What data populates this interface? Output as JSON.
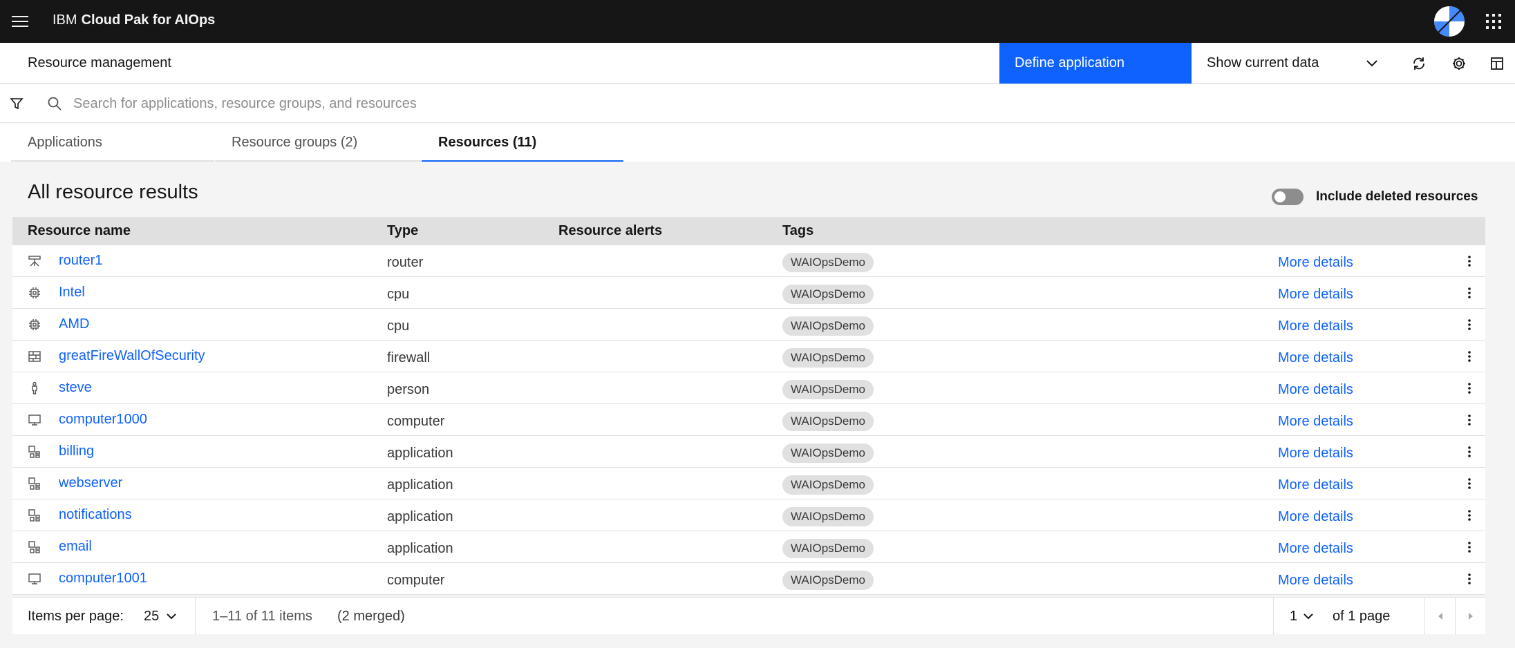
{
  "shell": {
    "brand_prefix": "IBM",
    "brand_product": "Cloud Pak for AIOps"
  },
  "page": {
    "title": "Resource management",
    "define_button": "Define application",
    "data_select_value": "Show current data"
  },
  "search": {
    "placeholder": "Search for applications, resource groups, and resources"
  },
  "tabs": [
    {
      "label": "Applications"
    },
    {
      "label": "Resource groups (2)"
    },
    {
      "label": "Resources (11)"
    }
  ],
  "results": {
    "title": "All resource results",
    "toggle_label": "Include deleted resources"
  },
  "table": {
    "headers": {
      "name": "Resource name",
      "type": "Type",
      "alerts": "Resource alerts",
      "tags": "Tags"
    },
    "rows": [
      {
        "name": "router1",
        "type": "router",
        "tag": "WAIOpsDemo",
        "more": "More details",
        "icon": "router-icon"
      },
      {
        "name": "Intel",
        "type": "cpu",
        "tag": "WAIOpsDemo",
        "more": "More details",
        "icon": "chip-icon"
      },
      {
        "name": "AMD",
        "type": "cpu",
        "tag": "WAIOpsDemo",
        "more": "More details",
        "icon": "chip-icon"
      },
      {
        "name": "greatFireWallOfSecurity",
        "type": "firewall",
        "tag": "WAIOpsDemo",
        "more": "More details",
        "icon": "firewall-icon"
      },
      {
        "name": "steve",
        "type": "person",
        "tag": "WAIOpsDemo",
        "more": "More details",
        "icon": "person-icon"
      },
      {
        "name": "computer1000",
        "type": "computer",
        "tag": "WAIOpsDemo",
        "more": "More details",
        "icon": "monitor-icon"
      },
      {
        "name": "billing",
        "type": "application",
        "tag": "WAIOpsDemo",
        "more": "More details",
        "icon": "application-icon"
      },
      {
        "name": "webserver",
        "type": "application",
        "tag": "WAIOpsDemo",
        "more": "More details",
        "icon": "application-icon"
      },
      {
        "name": "notifications",
        "type": "application",
        "tag": "WAIOpsDemo",
        "more": "More details",
        "icon": "application-icon"
      },
      {
        "name": "email",
        "type": "application",
        "tag": "WAIOpsDemo",
        "more": "More details",
        "icon": "application-icon"
      },
      {
        "name": "computer1001",
        "type": "computer",
        "tag": "WAIOpsDemo",
        "more": "More details",
        "icon": "monitor-icon"
      }
    ]
  },
  "pagination": {
    "items_per_page_label": "Items per page:",
    "items_per_page_value": "25",
    "range": "1–11 of 11 items",
    "merged": "(2 merged)",
    "page_value": "1",
    "of_pages": "of 1 page"
  },
  "colors": {
    "accent": "#0f62fe",
    "shell_bg": "#161616",
    "row_bg": "#ffffff",
    "header_bg": "#e0e0e0",
    "tag_bg": "#e0e0e0"
  }
}
